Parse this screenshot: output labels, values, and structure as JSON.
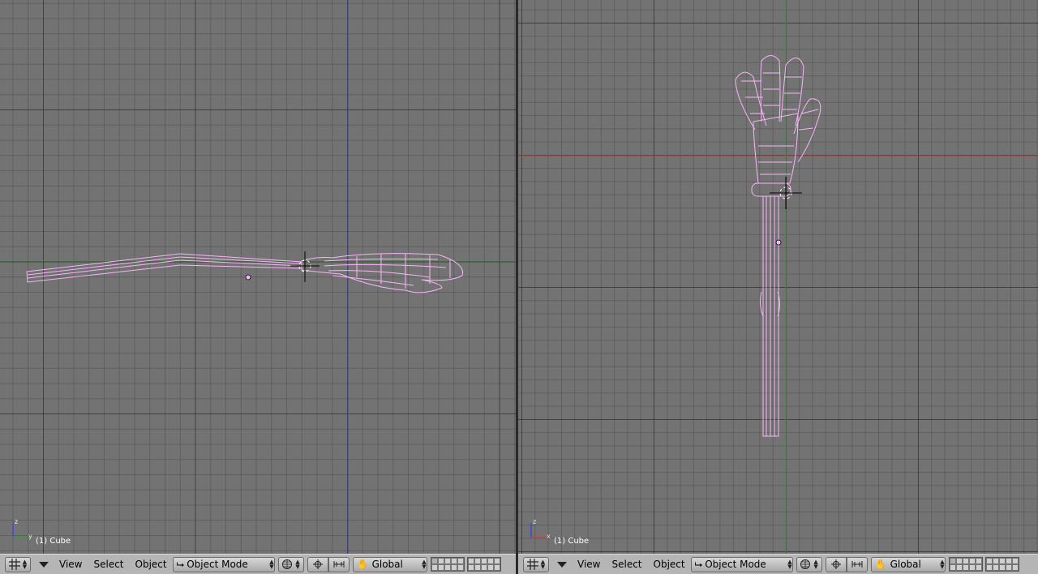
{
  "left_view": {
    "object_label": "(1) Cube",
    "axis": [
      "z",
      "x"
    ]
  },
  "right_view": {
    "object_label": "(1) Cube",
    "axis": [
      "z",
      "x"
    ]
  },
  "header": {
    "view_label": "View",
    "select_label": "Select",
    "object_label": "Object",
    "mode_value": "Object Mode",
    "orientation_value": "Global"
  },
  "colors": {
    "viewport_bg": "#737373",
    "mesh_wire": "#f7b5f7",
    "x_axis": "#b04040",
    "y_axis": "#4d8a4d",
    "z_axis": "#4545a5",
    "header_bg": "#b5b5b5"
  },
  "icons": [
    "view-grid-icon",
    "menu-arrow-icon",
    "mode-icon",
    "draw-type-icon",
    "pivot-icon",
    "manipulator-icon",
    "hand-icon"
  ]
}
